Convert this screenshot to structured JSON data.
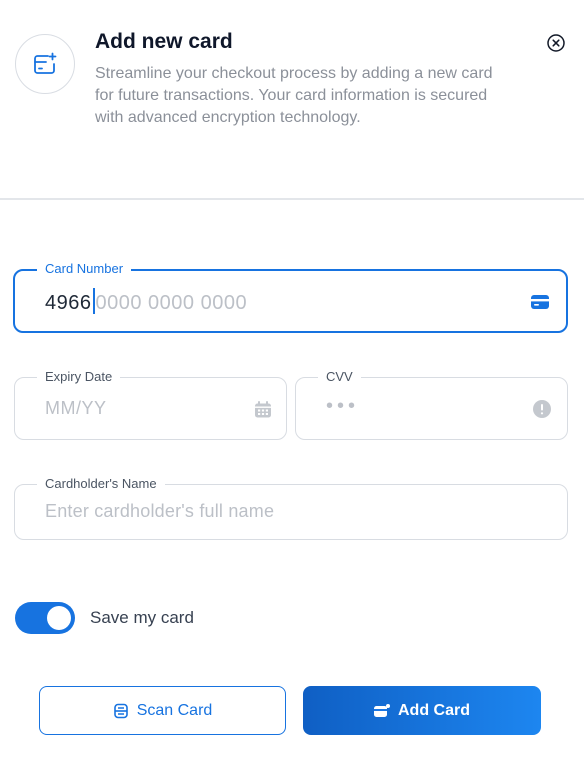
{
  "header": {
    "icon": "card-add-icon",
    "title": "Add new card",
    "subtitle": "Streamline your checkout process by adding a new card for future transactions. Your card information is secured with advanced encryption technology.",
    "close_icon": "close-circle-icon"
  },
  "card_number": {
    "label": "Card Number",
    "typed": "4966",
    "remaining_mask": "0000 0000 0000",
    "icon": "credit-card-icon"
  },
  "expiry": {
    "label": "Expiry Date",
    "placeholder": "MM/YY",
    "icon": "calendar-icon"
  },
  "cvv": {
    "label": "CVV",
    "placeholder": "•••",
    "icon": "info-circle-icon"
  },
  "cardholder": {
    "label": "Cardholder's Name",
    "placeholder": "Enter cardholder's full name"
  },
  "save_card": {
    "label": "Save my card",
    "enabled": true
  },
  "actions": {
    "scan_label": "Scan Card",
    "add_label": "Add Card"
  },
  "colors": {
    "accent": "#1773e0",
    "muted_text": "#8b9099",
    "placeholder": "#bcc0c7"
  }
}
